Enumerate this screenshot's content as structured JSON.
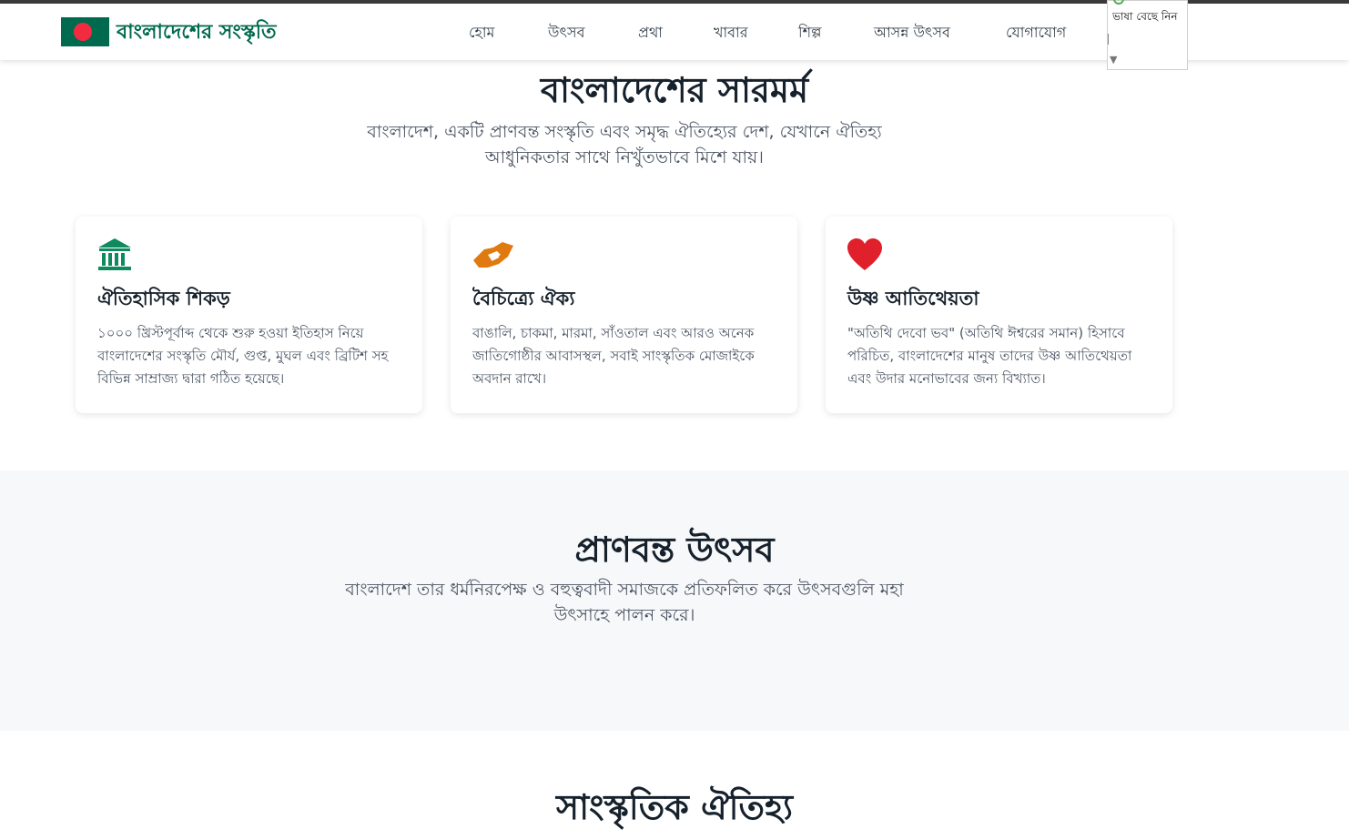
{
  "header": {
    "brand": "বাংলাদেশের সংস্কৃতি",
    "nav": [
      "হোম",
      "উৎসব",
      "প্রথা",
      "খাবার",
      "শিল্প",
      "আসন্ন উৎসব",
      "যোগাযোগ"
    ],
    "language_select": {
      "label": "ভাষা বেছে নিন",
      "caret": "▼"
    }
  },
  "essence": {
    "title": "বাংলাদেশের সারমর্ম",
    "subtitle": "বাংলাদেশ, একটি প্রাণবন্ত সংস্কৃতি এবং সমৃদ্ধ ঐতিহ্যের দেশ, যেখানে ঐতিহ্য আধুনিকতার সাথে নিখুঁতভাবে মিশে যায়।"
  },
  "cards": [
    {
      "icon": "museum-icon",
      "icon_color": "#0f8a5f",
      "title": "ঐতিহাসিক শিকড়",
      "text": "১০০০ খ্রিস্টপূর্বাব্দ থেকে শুরু হওয়া ইতিহাস নিয়ে বাংলাদেশের সংস্কৃতি মৌর্য, গুপ্ত, মুঘল এবং ব্রিটিশ সহ বিভিন্ন সাম্রাজ্য দ্বারা গঠিত হয়েছে।"
    },
    {
      "icon": "handshake-icon",
      "icon_color": "#e07a10",
      "title": "বৈচিত্র্যে ঐক্য",
      "text": "বাঙালি, চাকমা, মারমা, সাঁওতাল এবং আরও অনেক জাতিগোষ্ঠীর আবাসস্থল, সবাই সাংস্কৃতিক মোজাইকে অবদান রাখে।"
    },
    {
      "icon": "heart-icon",
      "icon_color": "#e0202a",
      "title": "উষ্ণ আতিথেয়তা",
      "text": "\"অতিথি দেবো ভব\" (অতিথি ঈশ্বরের সমান) হিসাবে পরিচিত, বাংলাদেশের মানুষ তাদের উষ্ণ আতিথেয়তা এবং উদার মনোভাবের জন্য বিখ্যাত।"
    }
  ],
  "festivals": {
    "title": "প্রাণবন্ত উৎসব",
    "subtitle": "বাংলাদেশ তার ধর্মনিরপেক্ষ ও বহুত্ববাদী সমাজকে প্রতিফলিত করে উৎসবগুলি মহা উৎসাহে পালন করে।"
  },
  "heritage": {
    "title": "সাংস্কৃতিক ঐতিহ্য"
  },
  "colors": {
    "brand_green": "#006a4e",
    "flag_red": "#f42a41",
    "band_bg": "#f7f8fa"
  }
}
